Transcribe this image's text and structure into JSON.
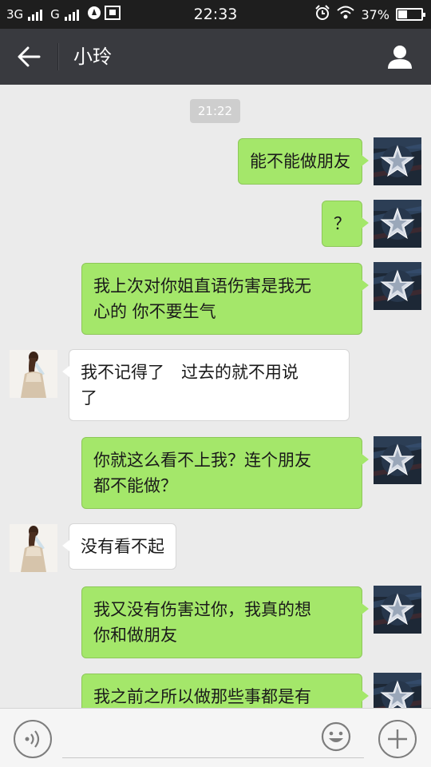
{
  "status_bar": {
    "network1": "3G",
    "network2": "G",
    "time": "22:33",
    "battery": "37%"
  },
  "header": {
    "back_icon": "arrow-left-icon",
    "title": "小玲",
    "profile_icon": "person-icon"
  },
  "chat": {
    "timestamp": "21:22",
    "messages": [
      {
        "from": "me",
        "text": "能不能做朋友"
      },
      {
        "from": "me",
        "text": "？"
      },
      {
        "from": "me",
        "line1": "我上次对你姐直语伤害是我无",
        "line2": "心的 你不要生气"
      },
      {
        "from": "contact",
        "line1": "我不记得了　过去的就不用说",
        "line2": "了"
      },
      {
        "from": "me",
        "line1": "你就这么看不上我？连个朋友",
        "line2": "都不能做？"
      },
      {
        "from": "contact",
        "text": "没有看不起"
      },
      {
        "from": "me",
        "line1": "我又没有伤害过你，我真的想",
        "line2": "你和做朋友"
      },
      {
        "from": "me",
        "line1": "我之前之所以做那些事都是有"
      }
    ]
  },
  "input_bar": {
    "voice_icon": "voice-icon",
    "text_value": "",
    "emoji_icon": "emoji-icon",
    "plus_icon": "plus-icon"
  },
  "colors": {
    "outgoing_bubble": "#a4e76a",
    "incoming_bubble": "#ffffff",
    "title_bar": "#393a3f",
    "status_bar": "#1e1e1e",
    "chat_background": "#ebebeb"
  }
}
